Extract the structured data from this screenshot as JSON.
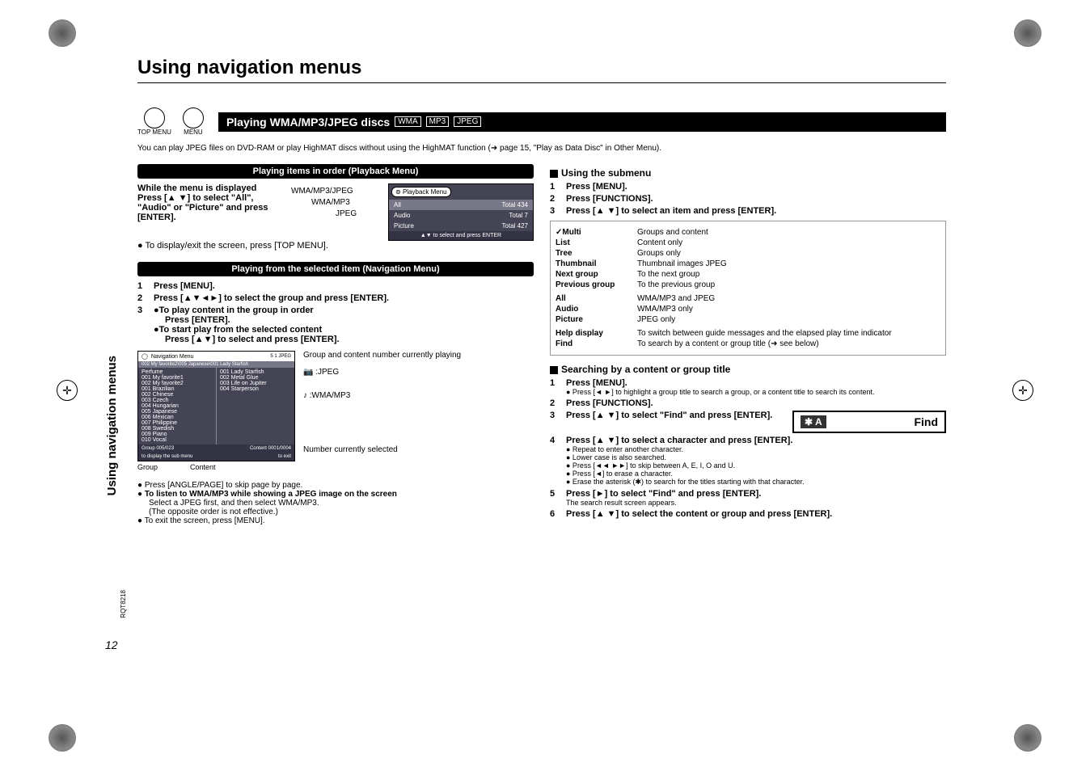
{
  "title": "Using navigation menus",
  "side_label": "Using navigation menus",
  "page_number": "12",
  "rqt": "RQT8218",
  "top_buttons": {
    "a": "TOP MENU",
    "b": "MENU"
  },
  "black_bar": {
    "text": "Playing WMA/MP3/JPEG discs",
    "tags": [
      "WMA",
      "MP3",
      "JPEG"
    ]
  },
  "note": "You can play JPEG files on DVD-RAM or play HighMAT discs without using the HighMAT function (➜ page 15, \"Play as Data Disc\" in Other Menu).",
  "left": {
    "header1": "Playing items in order (Playback Menu)",
    "p1a": "While the menu is displayed",
    "p1b": "Press [▲ ▼] to select \"All\", \"Audio\" or \"Picture\" and press [ENTER].",
    "p1c": "● To display/exit the screen, press [TOP MENU].",
    "label_wm3j": "WMA/MP3/JPEG",
    "label_wm3": "WMA/MP3",
    "label_jpeg": "JPEG",
    "playback": {
      "title": "Playback Menu",
      "rows": [
        {
          "k": "All",
          "v": "Total 434"
        },
        {
          "k": "Audio",
          "v": "Total 7"
        },
        {
          "k": "Picture",
          "v": "Total 427"
        }
      ],
      "foot": "▲▼ to select and press ENTER"
    },
    "header2": "Playing from the selected item (Navigation Menu)",
    "s1": "Press [MENU].",
    "s2": "Press [▲▼◄►] to select the group and press [ENTER].",
    "s3a": "●To play content in the group in order",
    "s3b": "Press [ENTER].",
    "s3c": "●To start play from the selected content",
    "s3d": "Press [▲▼] to select and press [ENTER].",
    "lbl_group_playing": "Group and content number currently playing",
    "lbl_jpeg_icon": ":JPEG",
    "lbl_wma_icon": ":WMA/MP3",
    "lbl_num_sel": "Number currently selected",
    "lbl_group": "Group",
    "lbl_content": "Content",
    "nav": {
      "title": "Navigation  Menu",
      "badges": "5   1     JPEG",
      "path": "002 My favorite2\\005 Japanese\\001 Lady Starfish",
      "left_col": [
        "Perfume",
        "001 My favorite1",
        "002 My favorite2",
        "001 Brazilian",
        "002 Chinese",
        "003 Czech",
        "004 Hungarian",
        "005 Japanese",
        "006 Mexican",
        "007 Philippine",
        "008 Swedish",
        "009 Piano",
        "010 Vocal"
      ],
      "right_col": [
        "001 Lady Starfish",
        "002 Metal Glue",
        "003 Life on Jupiter",
        "004 Starperson"
      ],
      "foot_group": "Group   005/023",
      "foot_content": "Content  0001/0004",
      "foot_left": "to  display  the  sub  menu",
      "foot_right": "to  exit"
    },
    "tips": [
      "● Press [ANGLE/PAGE] to skip page by page.",
      "● To listen to WMA/MP3 while showing a JPEG image on the screen",
      "Select a JPEG first, and then select WMA/MP3.",
      "(The opposite order is not effective.)",
      "● To exit the screen, press [MENU]."
    ]
  },
  "right": {
    "h1": "Using the submenu",
    "r1": "Press [MENU].",
    "r2": "Press [FUNCTIONS].",
    "r3": "Press [▲ ▼] to select an item and press [ENTER].",
    "submenu": [
      {
        "k": "✓Multi",
        "v": "Groups and content"
      },
      {
        "k": "List",
        "v": "Content only"
      },
      {
        "k": "Tree",
        "v": "Groups only"
      },
      {
        "k": "Thumbnail",
        "v": "Thumbnail images  JPEG"
      },
      {
        "k": "Next group",
        "v": "To the next group"
      },
      {
        "k": "Previous group",
        "v": "To the previous group"
      },
      {
        "k": "All",
        "v": "WMA/MP3 and JPEG"
      },
      {
        "k": "Audio",
        "v": "WMA/MP3 only"
      },
      {
        "k": "Picture",
        "v": "JPEG only"
      },
      {
        "k": "Help display",
        "v": "To switch between guide messages and the elapsed play time indicator"
      },
      {
        "k": "Find",
        "v": "To search by a content or group title (➜ see below)"
      }
    ],
    "h2": "Searching by a content or group title",
    "s1": "Press [MENU].",
    "s1b": "● Press [◄ ►] to highlight a group title to search a group, or a content title to search its content.",
    "s2": "Press [FUNCTIONS].",
    "s3": "Press [▲ ▼] to select \"Find\" and press [ENTER].",
    "find_a": "✱ A",
    "find_label": "Find",
    "s4": "Press [▲ ▼] to select a character and press [ENTER].",
    "s4a": "● Repeat to enter another character.",
    "s4b": "● Lower case is also searched.",
    "s4c": "● Press [◄◄ ►►] to skip between A, E, I, O and U.",
    "s4d": "● Press [◄] to erase a character.",
    "s4e": "● Erase the asterisk (✱) to search for the titles starting with that character.",
    "s5": "Press [►] to select \"Find\" and press [ENTER].",
    "s5a": "The search result screen appears.",
    "s6": "Press [▲ ▼] to select the content or group and press [ENTER]."
  }
}
